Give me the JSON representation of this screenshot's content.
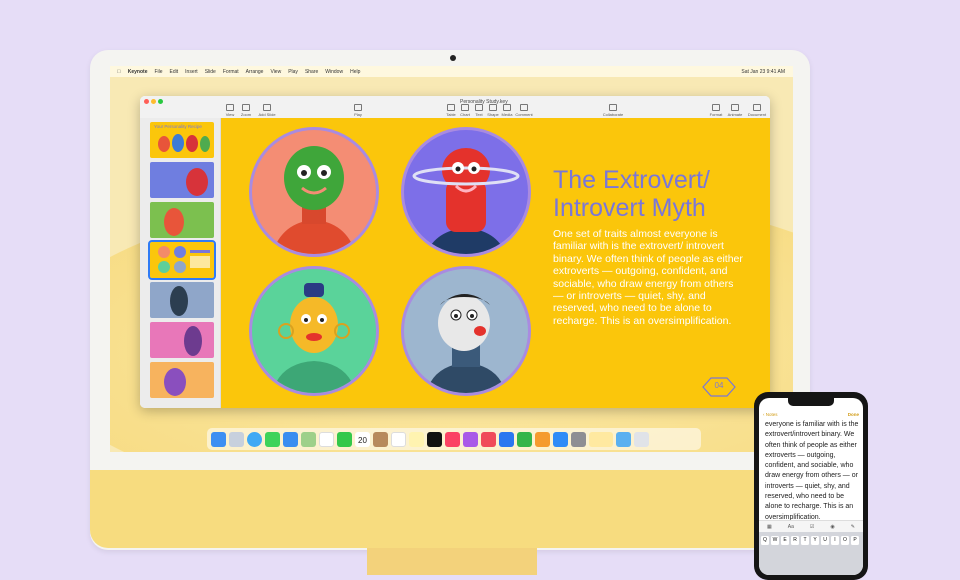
{
  "menubar": {
    "app": "Keynote",
    "items": [
      "File",
      "Edit",
      "Insert",
      "Slide",
      "Format",
      "Arrange",
      "View",
      "Play",
      "Share",
      "Window",
      "Help"
    ],
    "clock": "Sat Jan 23 9:41 AM"
  },
  "keynote": {
    "document_title": "Personality Study.key",
    "toolbar": {
      "view": "View",
      "zoom": "Zoom",
      "add_slide": "Add Slide",
      "play": "Play",
      "table": "Table",
      "chart": "Chart",
      "text": "Text",
      "shape": "Shape",
      "media": "Media",
      "comment": "Comment",
      "collaborate": "Collaborate",
      "format": "Format",
      "animate": "Animate",
      "document": "Document"
    },
    "thumbnails": [
      {
        "num": "1",
        "color": "#fbc60b",
        "title": "Your Personality Recipe"
      },
      {
        "num": "2",
        "color": "#6f7ee0"
      },
      {
        "num": "3",
        "color": "#7cc04f"
      },
      {
        "num": "4",
        "color": "#fbc60b"
      },
      {
        "num": "5",
        "color": "#8fa6c9"
      },
      {
        "num": "6",
        "color": "#e877b9"
      },
      {
        "num": "7",
        "color": "#f7b35e"
      }
    ],
    "slide": {
      "headline": "The Extrovert/ Introvert Myth",
      "paragraph": "One set of traits almost everyone is familiar with is the extrovert/ introvert binary. We often think of people as either extroverts — outgoing, confident, and sociable, who draw energy from others — or introverts — quiet, shy, and reserved, who need to be alone to recharge. This is an oversimplification.",
      "page_number": "04"
    }
  },
  "dock": {
    "icons": [
      "finder-icon",
      "launchpad-icon",
      "safari-icon",
      "messages-icon",
      "mail-icon",
      "maps-icon",
      "photos-icon",
      "facetime-icon",
      "calendar-icon",
      "contacts-icon",
      "reminders-icon",
      "notes-icon",
      "tv-icon",
      "music-icon",
      "podcasts-icon",
      "news-icon",
      "keynote-icon",
      "numbers-icon",
      "pages-icon",
      "app-store-icon",
      "system-preferences-icon",
      "notes-window-icon",
      "folder-icon",
      "trash-icon"
    ],
    "calendar_day": "20"
  },
  "iphone": {
    "back": "‹ Notes",
    "done": "Done",
    "note_text": "everyone is familiar with is the extrovert/introvert binary. We often think of people as either extroverts — outgoing, confident, and sociable, who draw energy from others — or introverts — quiet, shy, and reserved, who need to be alone to recharge. This is an oversimplification.",
    "keyboard_row": [
      "Q",
      "W",
      "E",
      "R",
      "T",
      "Y",
      "U",
      "I",
      "O",
      "P"
    ]
  }
}
